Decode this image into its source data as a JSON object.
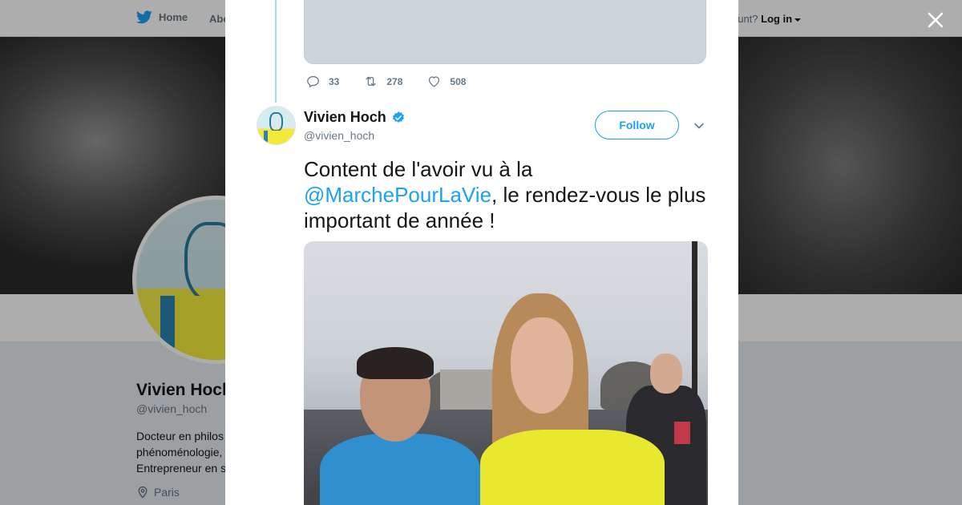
{
  "nav": {
    "home_label": "Home",
    "about_label": "Abo",
    "account_prompt": "ccount?",
    "login_label": "Log in"
  },
  "profile": {
    "name": "Vivien Hoch",
    "handle": "@vivien_hoch",
    "bio_lines": [
      "Docteur en philos",
      "phénoménologie,",
      "Entrepreneur en s"
    ],
    "location": "Paris"
  },
  "previous_tweet": {
    "replies": "33",
    "retweets": "278",
    "likes": "508"
  },
  "tweet": {
    "author_name": "Vivien Hoch",
    "author_handle": "@vivien_hoch",
    "follow_label": "Follow",
    "text_before": "Content de l'avoir vu à la ",
    "mention": "@MarchePourLaVie",
    "text_after": ", le rendez-vous le plus important de année !"
  },
  "colors": {
    "accent": "#1da1f2",
    "thread_line": "#a4d9f9"
  },
  "icons": [
    "twitter-bird-icon",
    "close-icon",
    "reply-icon",
    "retweet-icon",
    "like-icon",
    "verified-icon",
    "chevron-down-icon",
    "location-pin-icon"
  ]
}
